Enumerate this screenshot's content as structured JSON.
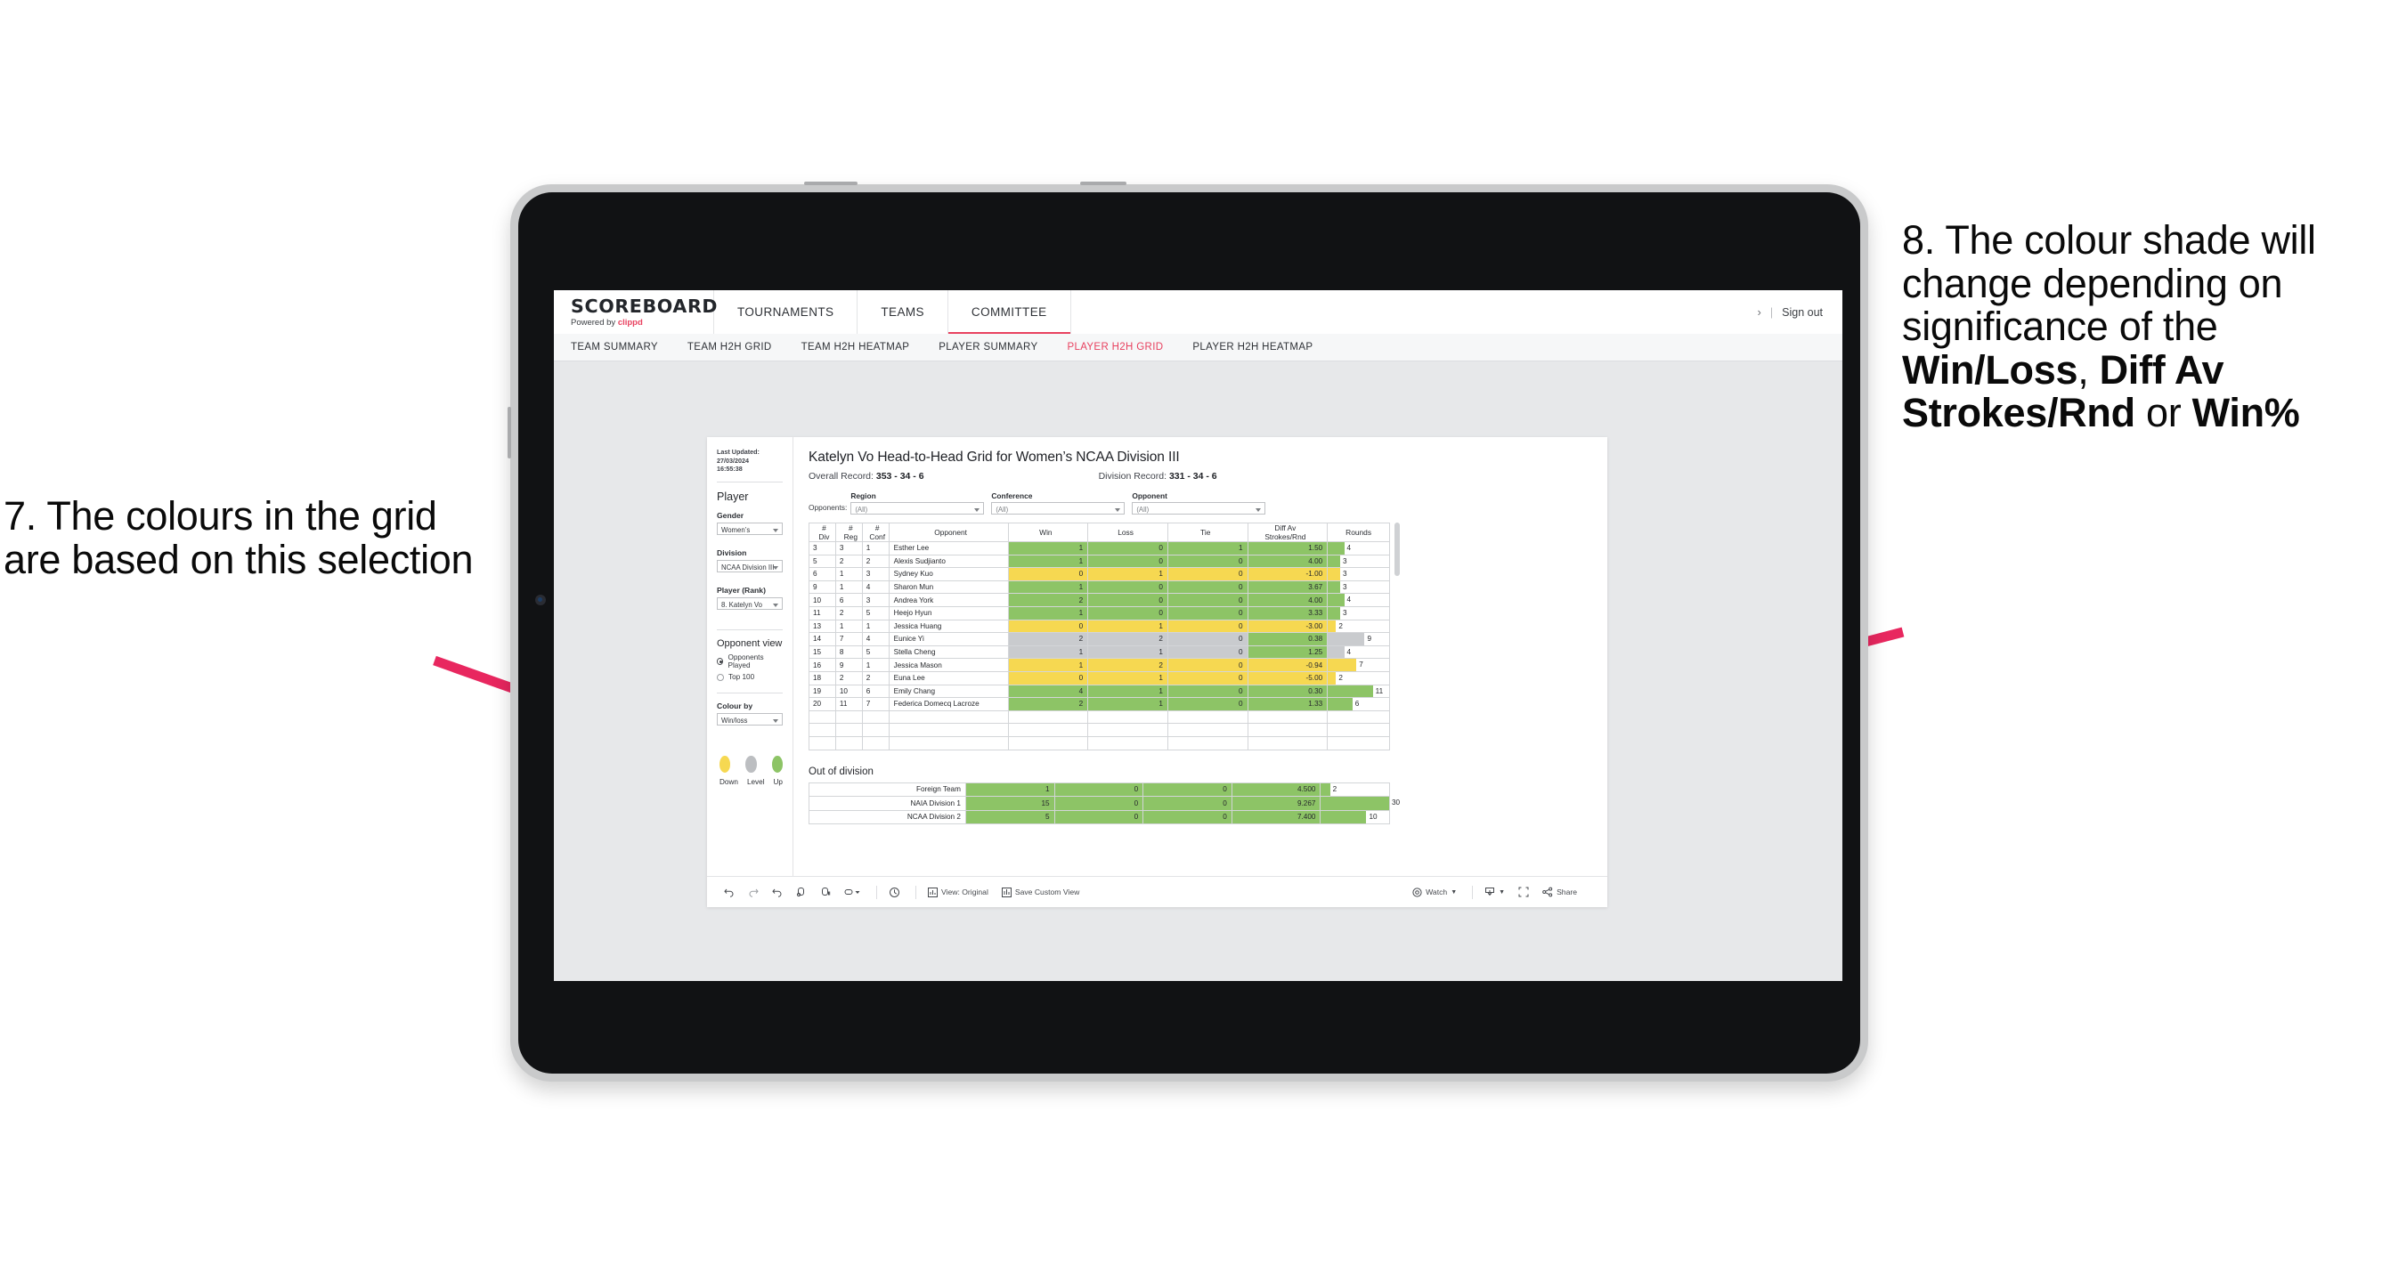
{
  "annotations": {
    "left": "7. The colours in the grid are based on this selection",
    "right_prefix": "8. The colour shade will change depending on significance of the ",
    "right_b1": "Win/Loss",
    "right_mid1": ", ",
    "right_b2": "Diff Av Strokes/Rnd",
    "right_mid2": " or ",
    "right_b3": "Win%",
    "arrow_color": "#e8275f"
  },
  "app": {
    "brand": {
      "title": "SCOREBOARD",
      "powered_prefix": "Powered by ",
      "powered_brand": "clippd"
    },
    "nav": [
      {
        "label": "TOURNAMENTS",
        "active": false
      },
      {
        "label": "TEAMS",
        "active": false
      },
      {
        "label": "COMMITTEE",
        "active": true
      }
    ],
    "account": {
      "chevron": "›",
      "separator": "|",
      "sign_out": "Sign out"
    },
    "subnav": [
      {
        "label": "TEAM SUMMARY",
        "active": false
      },
      {
        "label": "TEAM H2H GRID",
        "active": false
      },
      {
        "label": "TEAM H2H HEATMAP",
        "active": false
      },
      {
        "label": "PLAYER SUMMARY",
        "active": false
      },
      {
        "label": "PLAYER H2H GRID",
        "active": true
      },
      {
        "label": "PLAYER H2H HEATMAP",
        "active": false
      }
    ],
    "accent_color": "#e8415f"
  },
  "sidebar": {
    "last_updated_label": "Last Updated: 27/03/2024",
    "last_updated_time": "16:55:38",
    "player_heading": "Player",
    "gender_label": "Gender",
    "gender_value": "Women’s",
    "division_label": "Division",
    "division_value": "NCAA Division III",
    "player_rank_label": "Player (Rank)",
    "player_rank_value": "8. Katelyn Vo",
    "opponent_view_heading": "Opponent view",
    "opponent_view_options": [
      {
        "label": "Opponents Played",
        "selected": true
      },
      {
        "label": "Top 100",
        "selected": false
      }
    ],
    "colour_by_label": "Colour by",
    "colour_by_value": "Win/loss",
    "legend": [
      {
        "label": "Down",
        "color": "#f6d851"
      },
      {
        "label": "Level",
        "color": "#bcbec1"
      },
      {
        "label": "Up",
        "color": "#8dc466"
      }
    ]
  },
  "main": {
    "title": "Katelyn Vo Head-to-Head Grid for Women’s NCAA Division III",
    "overall_record_label": "Overall Record: ",
    "overall_record_value": "353 -  34 - 6",
    "division_record_label": "Division Record: ",
    "division_record_value": "331 -  34 - 6",
    "opponents_label": "Opponents:",
    "filters": [
      {
        "label": "Region",
        "value": "(All)"
      },
      {
        "label": "Conference",
        "value": "(All)"
      },
      {
        "label": "Opponent",
        "value": "(All)"
      }
    ],
    "columns": [
      "# Div",
      "# Reg",
      "# Conf",
      "Opponent",
      "Win",
      "Loss",
      "Tie",
      "Diff Av Strokes/Rnd",
      "Rounds"
    ],
    "col_div_l1": "#",
    "col_div_l2": "Div",
    "col_reg_l1": "#",
    "col_reg_l2": "Reg",
    "col_conf_l1": "#",
    "col_conf_l2": "Conf",
    "col_opp": "Opponent",
    "col_win": "Win",
    "col_loss": "Loss",
    "col_tie": "Tie",
    "col_diff_l1": "Diff Av",
    "col_diff_l2": "Strokes/Rnd",
    "col_rounds": "Rounds",
    "out_of_division_title": "Out of division"
  },
  "chart_data": {
    "type": "table",
    "title": "Katelyn Vo Head-to-Head Grid for Women’s NCAA Division III",
    "columns": [
      "# Div",
      "# Reg",
      "# Conf",
      "Opponent",
      "Win",
      "Loss",
      "Tie",
      "Diff Av Strokes/Rnd",
      "Rounds"
    ],
    "max_rounds": 30,
    "colors": {
      "up": "#8dc466",
      "down": "#f6d851",
      "level": "#c9cbce"
    },
    "rows": [
      {
        "div": "3",
        "reg": "3",
        "conf": "1",
        "opponent": "Esther Lee",
        "win": "1",
        "loss": "0",
        "tie": "1",
        "diff": "1.50",
        "rounds": "4",
        "state": "up"
      },
      {
        "div": "5",
        "reg": "2",
        "conf": "2",
        "opponent": "Alexis Sudjianto",
        "win": "1",
        "loss": "0",
        "tie": "0",
        "diff": "4.00",
        "rounds": "3",
        "state": "up"
      },
      {
        "div": "6",
        "reg": "1",
        "conf": "3",
        "opponent": "Sydney Kuo",
        "win": "0",
        "loss": "1",
        "tie": "0",
        "diff": "-1.00",
        "rounds": "3",
        "state": "down"
      },
      {
        "div": "9",
        "reg": "1",
        "conf": "4",
        "opponent": "Sharon Mun",
        "win": "1",
        "loss": "0",
        "tie": "0",
        "diff": "3.67",
        "rounds": "3",
        "state": "up"
      },
      {
        "div": "10",
        "reg": "6",
        "conf": "3",
        "opponent": "Andrea York",
        "win": "2",
        "loss": "0",
        "tie": "0",
        "diff": "4.00",
        "rounds": "4",
        "state": "up"
      },
      {
        "div": "11",
        "reg": "2",
        "conf": "5",
        "opponent": "Heejo Hyun",
        "win": "1",
        "loss": "0",
        "tie": "0",
        "diff": "3.33",
        "rounds": "3",
        "state": "up"
      },
      {
        "div": "13",
        "reg": "1",
        "conf": "1",
        "opponent": "Jessica Huang",
        "win": "0",
        "loss": "1",
        "tie": "0",
        "diff": "-3.00",
        "rounds": "2",
        "state": "down"
      },
      {
        "div": "14",
        "reg": "7",
        "conf": "4",
        "opponent": "Eunice Yi",
        "win": "2",
        "loss": "2",
        "tie": "0",
        "diff": "0.38",
        "rounds": "9",
        "state": "level",
        "diff_state": "up"
      },
      {
        "div": "15",
        "reg": "8",
        "conf": "5",
        "opponent": "Stella Cheng",
        "win": "1",
        "loss": "1",
        "tie": "0",
        "diff": "1.25",
        "rounds": "4",
        "state": "level",
        "diff_state": "up"
      },
      {
        "div": "16",
        "reg": "9",
        "conf": "1",
        "opponent": "Jessica Mason",
        "win": "1",
        "loss": "2",
        "tie": "0",
        "diff": "-0.94",
        "rounds": "7",
        "state": "down"
      },
      {
        "div": "18",
        "reg": "2",
        "conf": "2",
        "opponent": "Euna Lee",
        "win": "0",
        "loss": "1",
        "tie": "0",
        "diff": "-5.00",
        "rounds": "2",
        "state": "down"
      },
      {
        "div": "19",
        "reg": "10",
        "conf": "6",
        "opponent": "Emily Chang",
        "win": "4",
        "loss": "1",
        "tie": "0",
        "diff": "0.30",
        "rounds": "11",
        "state": "up"
      },
      {
        "div": "20",
        "reg": "11",
        "conf": "7",
        "opponent": "Federica Domecq Lacroze",
        "win": "2",
        "loss": "1",
        "tie": "0",
        "diff": "1.33",
        "rounds": "6",
        "state": "up"
      }
    ],
    "out_of_division": [
      {
        "opponent": "Foreign Team",
        "win": "1",
        "loss": "0",
        "tie": "0",
        "diff": "4.500",
        "rounds": "2",
        "state": "up"
      },
      {
        "opponent": "NAIA Division 1",
        "win": "15",
        "loss": "0",
        "tie": "0",
        "diff": "9.267",
        "rounds": "30",
        "state": "up"
      },
      {
        "opponent": "NCAA Division 2",
        "win": "5",
        "loss": "0",
        "tie": "0",
        "diff": "7.400",
        "rounds": "10",
        "state": "up"
      }
    ]
  },
  "toolbar": {
    "items": [
      {
        "name": "undo",
        "label": ""
      },
      {
        "name": "redo",
        "label": ""
      },
      {
        "name": "revert",
        "label": ""
      },
      {
        "name": "refresh",
        "label": ""
      },
      {
        "name": "pause",
        "label": ""
      },
      {
        "name": "highlight",
        "label": ""
      },
      {
        "name": "alerts",
        "label": ""
      }
    ],
    "view_label": "View: Original",
    "save_label": "Save Custom View",
    "watch_label": "Watch",
    "share_label": "Share"
  }
}
